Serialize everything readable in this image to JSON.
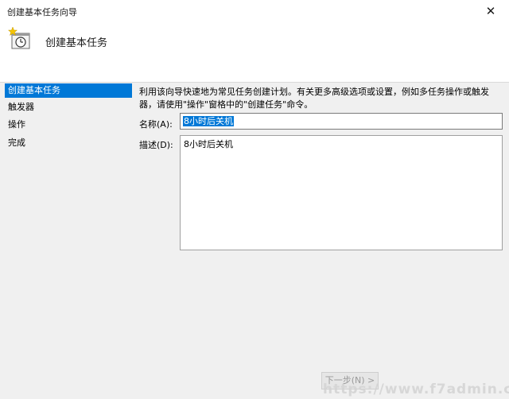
{
  "window": {
    "title": "创建基本任务向导",
    "close_glyph": "✕"
  },
  "header": {
    "title": "创建基本任务",
    "icon": "clock-task-icon"
  },
  "sidebar": {
    "items": [
      {
        "label": "创建基本任务",
        "active": true
      },
      {
        "label": "触发器",
        "active": false
      },
      {
        "label": "操作",
        "active": false
      },
      {
        "label": "完成",
        "active": false
      }
    ]
  },
  "main": {
    "description": "利用该向导快速地为常见任务创建计划。有关更多高级选项或设置，例如多任务操作或触发器，请使用\"操作\"窗格中的\"创建任务\"命令。",
    "name_label": "名称(A):",
    "name_value": "8小时后关机",
    "desc_label": "描述(D):",
    "desc_value": "8小时后关机"
  },
  "footer": {
    "next_label": "下一步(N) >"
  },
  "watermark": "https://www.f7admin.cn",
  "colors": {
    "accent": "#0078d7",
    "panel_bg": "#f0f0f0"
  }
}
